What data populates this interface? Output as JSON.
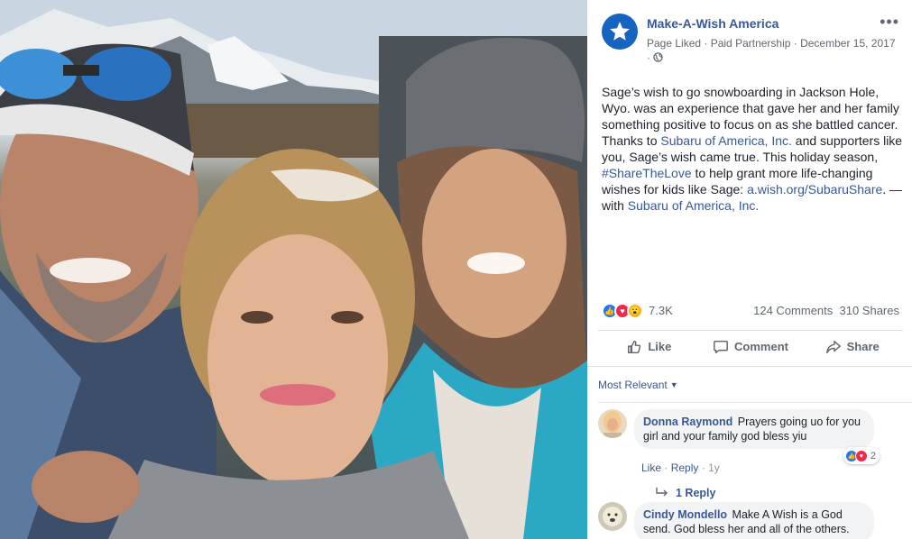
{
  "post": {
    "page_name": "Make-A-Wish America",
    "meta_line": "Page Liked · Paid Partnership · December 15, 2017",
    "meta_dot": "·",
    "more_icon": "more-dots-icon",
    "text_parts": [
      "Sage’s wish to go snowboarding in Jackson Hole, Wyo. was an experience that gave her and her family something positive to focus on as she battled cancer. Thanks to ",
      "Subaru of America, Inc.",
      " and supporters like you, Sage’s wish came true. This holiday season, ",
      "#ShareTheLove",
      " to help grant more life-changing wishes for kids like Sage: ",
      "a.wish.org/SubaruShare",
      ". — with ",
      "Subaru of America, Inc."
    ]
  },
  "reactions": {
    "total": "7.3K",
    "comments": "124 Comments",
    "shares": "310 Shares",
    "types": [
      "like",
      "love",
      "wow"
    ]
  },
  "actions": {
    "like": "Like",
    "comment": "Comment",
    "share": "Share"
  },
  "comments": {
    "sort_label": "Most Relevant",
    "items": [
      {
        "author": "Donna Raymond",
        "text": "Prayers going uo for you girl and your family god bless yiu",
        "like_label": "Like",
        "reply_label": "Reply",
        "time": "1y",
        "reaction_count": "2",
        "replies_label": "1 Reply"
      },
      {
        "author": "Cindy Mondello",
        "text": "Make A Wish is a God send. God bless her and all of the others."
      }
    ]
  },
  "colors": {
    "link": "#385898",
    "brand_avatar": "#1565c0",
    "like_blue": "#2078f4",
    "love_red": "#f0284a"
  }
}
